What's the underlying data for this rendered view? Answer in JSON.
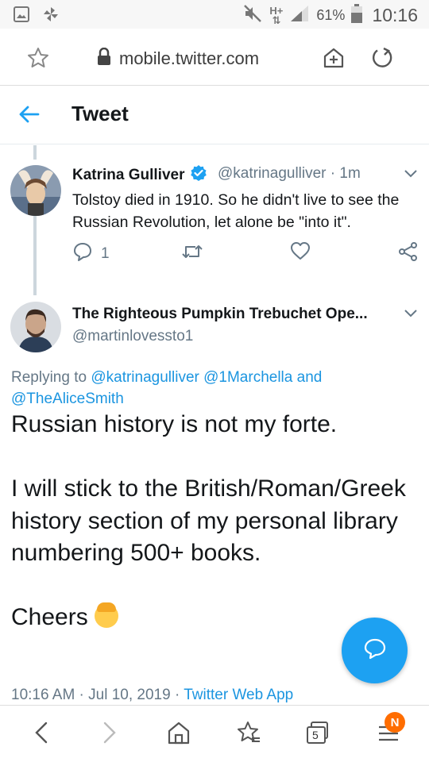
{
  "status_bar": {
    "network": "H+",
    "battery_percent": "61%",
    "time": "10:16"
  },
  "browser": {
    "url": "mobile.twitter.com"
  },
  "header": {
    "title": "Tweet"
  },
  "parent_tweet": {
    "author_name": "Katrina Gulliver",
    "handle_time": "@katrinagulliver · 1m",
    "text": "Tolstoy died in 1910. So he didn't live to see the Russian Revolution, let alone be \"into it\".",
    "reply_count": "1"
  },
  "main_tweet": {
    "author_name": "The Righteous Pumpkin Trebuchet Ope...",
    "handle": "@martinlovessto1",
    "replying_to_prefix": "Replying to ",
    "replying_to_links": "@katrinagulliver @1Marchella",
    "replying_to_and": " and ",
    "replying_to_last": "@TheAliceSmith",
    "body": "Russian history is not my forte.\n\nI will stick to the British/Roman/Greek history section of my personal library numbering 500+ books.\n\nCheers",
    "timestamp": "10:16 AM · Jul 10, 2019 · ",
    "source": "Twitter Web App"
  },
  "bottom_nav": {
    "tabs_count": "5",
    "notification_badge": "N"
  },
  "colors": {
    "twitter_blue": "#1da1f2",
    "link_blue": "#1b95e0",
    "gray_text": "#657786",
    "badge_orange": "#ff6d00"
  }
}
